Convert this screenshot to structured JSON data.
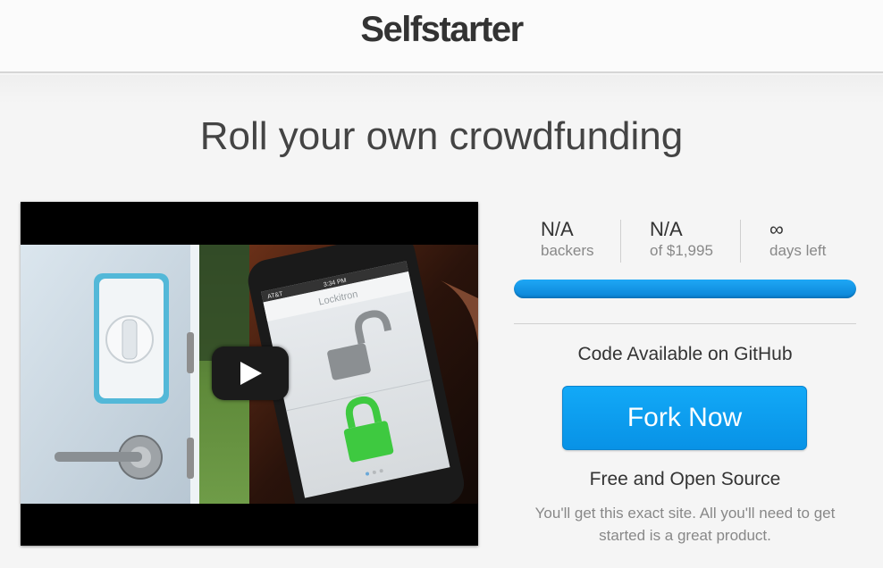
{
  "header": {
    "brand": "Selfstarter"
  },
  "hero": {
    "tagline": "Roll your own crowdfunding"
  },
  "video": {
    "play_icon": "play-icon",
    "phone_app_title": "Lockitron",
    "phone_carrier": "AT&T",
    "phone_time": "3:34 PM"
  },
  "stats": {
    "backers": {
      "value": "N/A",
      "label": "backers"
    },
    "raised": {
      "value": "N/A",
      "label": "of $1,995"
    },
    "days": {
      "value": "∞",
      "label": "days left"
    }
  },
  "progress": {
    "percent": 100,
    "color": "#1ea7f5"
  },
  "cta": {
    "github_text": "Code Available on GitHub",
    "button_label": "Fork Now",
    "button_color": "#12a9f7",
    "oss_title": "Free and Open Source",
    "oss_text": "You'll get this exact site. All you'll need to get started is a great product."
  }
}
